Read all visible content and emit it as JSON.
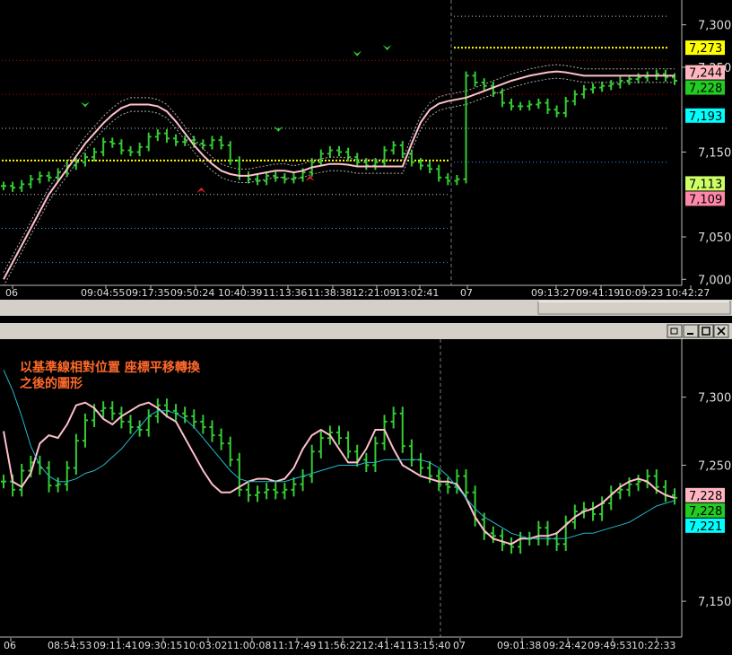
{
  "chart_data": [
    {
      "type": "candlestick",
      "title": "",
      "y_ticks": [
        7000,
        7050,
        7150,
        7250,
        7300
      ],
      "ylim": [
        6995,
        7325
      ],
      "x_tick_labels": [
        "06",
        "09:04:55",
        "09:17:35",
        "09:50:24",
        "10:40:39",
        "11:13:36",
        "11:38:38",
        "12:21:09",
        "13:02:41",
        "07",
        "09:13:27",
        "09:41:19",
        "10:09:23",
        "10:42:27"
      ],
      "price_labels": [
        {
          "value": 7273,
          "text": "7,273",
          "color": "#ffff00"
        },
        {
          "value": 7244,
          "text": "7,244",
          "color": "#ffb6c1"
        },
        {
          "value": 7228,
          "text": "7,228",
          "color": "#22cc22"
        },
        {
          "value": 7193,
          "text": "7,193",
          "color": "#00ffff"
        },
        {
          "value": 7113,
          "text": "7,113",
          "color": "#ccff66"
        },
        {
          "value": 7109,
          "text": "7,109",
          "color": "#ff88aa"
        }
      ],
      "reference_lines": [
        {
          "value": 7310,
          "color": "#cccccc",
          "segment": "day2"
        },
        {
          "value": 7273,
          "color": "#ffff00",
          "segment": "day2"
        },
        {
          "value": 7258,
          "color": "#cc0000",
          "segment": "day1"
        },
        {
          "value": 7258,
          "color": "#cc0000",
          "segment": "day2"
        },
        {
          "value": 7218,
          "color": "#cc0000",
          "segment": "day1"
        },
        {
          "value": 7218,
          "color": "#cc0000",
          "segment": "day2"
        },
        {
          "value": 7178,
          "color": "#cccccc",
          "segment": "day1"
        },
        {
          "value": 7178,
          "color": "#cccccc",
          "segment": "day2"
        },
        {
          "value": 7140,
          "color": "#ffff00",
          "segment": "day1"
        },
        {
          "value": 7138,
          "color": "#3399ff",
          "segment": "day2"
        },
        {
          "value": 7100,
          "color": "#cccccc",
          "segment": "day1"
        },
        {
          "value": 7060,
          "color": "#3399ff",
          "segment": "day1"
        },
        {
          "value": 7020,
          "color": "#3399ff",
          "segment": "day1"
        }
      ],
      "series": [
        {
          "name": "",
          "color": "#33cc33",
          "x": [
            0,
            10,
            20,
            30,
            40,
            50,
            60,
            70,
            80,
            90,
            100,
            110,
            120,
            130,
            140,
            150,
            160,
            170,
            180,
            190,
            200,
            210,
            220,
            230,
            240,
            250,
            260,
            270,
            280,
            290,
            300,
            310,
            320,
            330,
            340,
            350,
            360,
            370,
            380,
            390,
            400,
            410,
            420,
            430,
            440,
            450,
            460,
            470,
            480,
            490,
            500,
            510,
            520,
            530,
            540,
            550,
            560,
            570,
            580,
            590,
            600,
            610,
            620,
            630,
            640,
            650,
            660,
            670,
            680,
            690,
            700,
            710,
            720,
            730,
            740
          ],
          "values": [
            7110,
            7108,
            7112,
            7118,
            7122,
            7120,
            7126,
            7134,
            7138,
            7144,
            7150,
            7162,
            7160,
            7152,
            7150,
            7156,
            7168,
            7172,
            7166,
            7162,
            7164,
            7160,
            7158,
            7164,
            7158,
            7140,
            7122,
            7118,
            7116,
            7122,
            7120,
            7118,
            7120,
            7126,
            7138,
            7148,
            7152,
            7150,
            7144,
            7138,
            7134,
            7138,
            7152,
            7158,
            7148,
            7138,
            7134,
            7130,
            7120,
            7116,
            7118,
            7240,
            7232,
            7228,
            7220,
            7208,
            7204,
            7204,
            7206,
            7208,
            7200,
            7196,
            7210,
            7218,
            7224,
            7226,
            7228,
            7230,
            7234,
            7236,
            7238,
            7240,
            7242,
            7238,
            7234
          ]
        },
        {
          "name": "",
          "color": "#ffc0cb",
          "x": [
            0,
            10,
            20,
            30,
            40,
            50,
            60,
            70,
            80,
            90,
            100,
            110,
            120,
            130,
            140,
            150,
            160,
            170,
            180,
            190,
            200,
            210,
            220,
            230,
            240,
            250,
            260,
            270,
            280,
            290,
            300,
            310,
            320,
            330,
            340,
            350,
            360,
            370,
            380,
            390,
            400,
            410,
            420,
            430,
            440,
            450,
            460,
            470,
            480,
            490,
            500,
            510,
            520,
            530,
            540,
            550,
            560,
            570,
            580,
            590,
            600,
            610,
            620,
            630,
            640,
            650,
            660,
            670,
            680,
            690,
            700,
            710,
            720,
            730,
            740
          ],
          "values": [
            7000,
            7020,
            7040,
            7060,
            7080,
            7100,
            7115,
            7130,
            7145,
            7160,
            7172,
            7184,
            7194,
            7202,
            7206,
            7206,
            7206,
            7204,
            7198,
            7186,
            7172,
            7158,
            7146,
            7136,
            7128,
            7124,
            7122,
            7122,
            7124,
            7126,
            7128,
            7128,
            7126,
            7128,
            7132,
            7134,
            7136,
            7136,
            7135,
            7133,
            7133,
            7133,
            7133,
            7133,
            7133,
            7160,
            7185,
            7200,
            7207,
            7210,
            7212,
            7214,
            7218,
            7222,
            7226,
            7230,
            7234,
            7237,
            7240,
            7242,
            7244,
            7245,
            7244,
            7242,
            7240,
            7240,
            7240,
            7240,
            7240,
            7240,
            7240,
            7240,
            7240,
            7240,
            7240
          ]
        }
      ],
      "markers": [
        {
          "x": 90,
          "value": 7205,
          "type": "down",
          "color": "#33cc33"
        },
        {
          "x": 218,
          "value": 7106,
          "type": "up",
          "color": "#ff2222"
        },
        {
          "x": 303,
          "value": 7176,
          "type": "down",
          "color": "#33cc33"
        },
        {
          "x": 338,
          "value": 7120,
          "type": "up",
          "color": "#ff2222"
        },
        {
          "x": 390,
          "value": 7265,
          "type": "down",
          "color": "#33cc33"
        },
        {
          "x": 423,
          "value": 7272,
          "type": "down",
          "color": "#33cc33"
        }
      ]
    },
    {
      "type": "candlestick",
      "title": "",
      "annotation_lines": [
        "以基準線相對位置 座標平移轉換",
        "之後的圖形"
      ],
      "y_ticks": [
        7150,
        7250,
        7300
      ],
      "ylim": [
        7125,
        7340
      ],
      "x_tick_labels": [
        "06",
        "08:54:53",
        "09:11:41",
        "09:30:15",
        "10:03:02",
        "11:00:08",
        "11:17:49",
        "11:56:22",
        "12:41:41",
        "13:15:40",
        "07",
        "09:01:38",
        "09:24:42",
        "09:49:53",
        "10:22:33"
      ],
      "price_labels": [
        {
          "value": 7228,
          "text": "7,228",
          "color": "#ffb6c1"
        },
        {
          "value": 7228,
          "text": "7,228",
          "color": "#22cc22"
        },
        {
          "value": 7221,
          "text": "7,221",
          "color": "#00ffff"
        }
      ],
      "series": [
        {
          "name": "",
          "color": "#33cc33",
          "x": [
            0,
            10,
            20,
            30,
            40,
            50,
            60,
            70,
            80,
            90,
            100,
            110,
            120,
            130,
            140,
            150,
            160,
            170,
            180,
            190,
            200,
            210,
            220,
            230,
            240,
            250,
            260,
            270,
            280,
            290,
            300,
            310,
            320,
            330,
            340,
            350,
            360,
            370,
            380,
            390,
            400,
            410,
            420,
            430,
            440,
            450,
            460,
            470,
            480,
            490,
            500,
            510,
            520,
            530,
            540,
            550,
            560,
            570,
            580,
            590,
            600,
            610,
            620,
            630,
            640,
            650,
            660,
            670,
            680,
            690,
            700,
            710,
            720,
            730,
            740
          ],
          "values": [
            7238,
            7232,
            7246,
            7252,
            7248,
            7235,
            7236,
            7248,
            7268,
            7283,
            7290,
            7292,
            7288,
            7282,
            7278,
            7276,
            7286,
            7294,
            7290,
            7288,
            7286,
            7282,
            7278,
            7272,
            7266,
            7254,
            7232,
            7228,
            7230,
            7232,
            7230,
            7232,
            7236,
            7242,
            7260,
            7270,
            7274,
            7270,
            7260,
            7254,
            7250,
            7266,
            7282,
            7288,
            7264,
            7254,
            7248,
            7242,
            7236,
            7234,
            7242,
            7230,
            7210,
            7200,
            7198,
            7192,
            7190,
            7196,
            7196,
            7204,
            7196,
            7192,
            7208,
            7216,
            7218,
            7214,
            7222,
            7230,
            7232,
            7236,
            7238,
            7242,
            7234,
            7228,
            7226
          ]
        },
        {
          "name": "",
          "color": "#ffc0cb",
          "x": [
            0,
            10,
            20,
            30,
            40,
            50,
            60,
            70,
            80,
            90,
            100,
            110,
            120,
            130,
            140,
            150,
            160,
            170,
            180,
            190,
            200,
            210,
            220,
            230,
            240,
            250,
            260,
            270,
            280,
            290,
            300,
            310,
            320,
            330,
            340,
            350,
            360,
            370,
            380,
            390,
            400,
            410,
            420,
            430,
            440,
            450,
            460,
            470,
            480,
            490,
            500,
            510,
            520,
            530,
            540,
            550,
            560,
            570,
            580,
            590,
            600,
            610,
            620,
            630,
            640,
            650,
            660,
            670,
            680,
            690,
            700,
            710,
            720,
            730,
            740
          ],
          "values": [
            7275,
            7238,
            7234,
            7244,
            7266,
            7272,
            7270,
            7280,
            7294,
            7296,
            7292,
            7284,
            7280,
            7286,
            7290,
            7294,
            7296,
            7292,
            7286,
            7282,
            7270,
            7258,
            7246,
            7236,
            7230,
            7230,
            7234,
            7238,
            7240,
            7240,
            7238,
            7240,
            7248,
            7262,
            7272,
            7276,
            7272,
            7262,
            7252,
            7252,
            7262,
            7276,
            7276,
            7262,
            7250,
            7246,
            7242,
            7240,
            7238,
            7238,
            7236,
            7226,
            7212,
            7202,
            7196,
            7194,
            7192,
            7196,
            7196,
            7198,
            7198,
            7200,
            7206,
            7212,
            7216,
            7218,
            7222,
            7228,
            7234,
            7238,
            7240,
            7238,
            7232,
            7228,
            7226
          ]
        },
        {
          "name": "",
          "color": "#22bbcc",
          "x": [
            0,
            10,
            20,
            30,
            40,
            50,
            60,
            70,
            80,
            90,
            100,
            110,
            120,
            130,
            140,
            150,
            160,
            170,
            180,
            190,
            200,
            210,
            220,
            230,
            240,
            250,
            260,
            270,
            280,
            290,
            300,
            310,
            320,
            330,
            340,
            350,
            360,
            370,
            380,
            390,
            400,
            410,
            420,
            430,
            440,
            450,
            460,
            470,
            480,
            490,
            500,
            510,
            520,
            530,
            540,
            550,
            560,
            570,
            580,
            590,
            600,
            610,
            620,
            630,
            640,
            650,
            660,
            670,
            680,
            690,
            700,
            710,
            720,
            730,
            740
          ],
          "values": [
            7320,
            7305,
            7286,
            7264,
            7250,
            7242,
            7238,
            7238,
            7240,
            7244,
            7246,
            7250,
            7256,
            7262,
            7270,
            7278,
            7286,
            7290,
            7290,
            7288,
            7284,
            7278,
            7270,
            7262,
            7254,
            7246,
            7240,
            7238,
            7238,
            7238,
            7238,
            7238,
            7240,
            7242,
            7244,
            7246,
            7248,
            7250,
            7250,
            7250,
            7252,
            7252,
            7254,
            7254,
            7254,
            7254,
            7254,
            7252,
            7248,
            7242,
            7234,
            7226,
            7218,
            7212,
            7208,
            7204,
            7200,
            7198,
            7196,
            7196,
            7196,
            7196,
            7196,
            7198,
            7200,
            7200,
            7202,
            7204,
            7206,
            7208,
            7212,
            7216,
            7220,
            7222,
            7224
          ]
        }
      ]
    }
  ]
}
